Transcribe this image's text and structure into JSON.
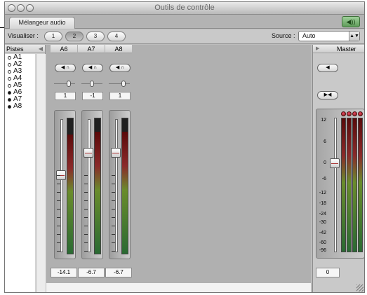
{
  "window": {
    "title": "Outils de contrôle"
  },
  "tabs": [
    {
      "label": "Mélangeur audio"
    }
  ],
  "toolbar": {
    "view_label": "Visualiser :",
    "view_buttons": [
      "1",
      "2",
      "3",
      "4"
    ],
    "selected_view": "2",
    "source_label": "Source :",
    "source_value": "Auto"
  },
  "tracks_panel": {
    "header": "Pistes",
    "tracks": [
      {
        "name": "A1",
        "visible": false
      },
      {
        "name": "A2",
        "visible": false
      },
      {
        "name": "A3",
        "visible": false
      },
      {
        "name": "A4",
        "visible": false
      },
      {
        "name": "A5",
        "visible": false
      },
      {
        "name": "A6",
        "visible": true
      },
      {
        "name": "A7",
        "visible": true
      },
      {
        "name": "A8",
        "visible": true
      }
    ]
  },
  "strips": [
    {
      "name": "A6",
      "pan": "1",
      "volume": "-14.1",
      "fader_db": -14.1,
      "meter_level": 0.88
    },
    {
      "name": "A7",
      "pan": "-1",
      "volume": "-6.7",
      "fader_db": -6.7,
      "meter_level": 0.9
    },
    {
      "name": "A8",
      "pan": "1",
      "volume": "-6.7",
      "fader_db": -6.7,
      "meter_level": 0.9
    }
  ],
  "master": {
    "label": "Master",
    "volume": "0",
    "fader_db": 0,
    "scale": [
      "12",
      "6",
      "0",
      "-6",
      "-12",
      "-18",
      "-24",
      "-30",
      "-42",
      "-60",
      "-96"
    ]
  },
  "colors": {
    "meter_top": "#5a0a0a",
    "meter_mid": "#6a8c2c",
    "meter_bottom": "#2a6a33",
    "peak": "#cc2244",
    "tab_green": "#7fb77a"
  }
}
